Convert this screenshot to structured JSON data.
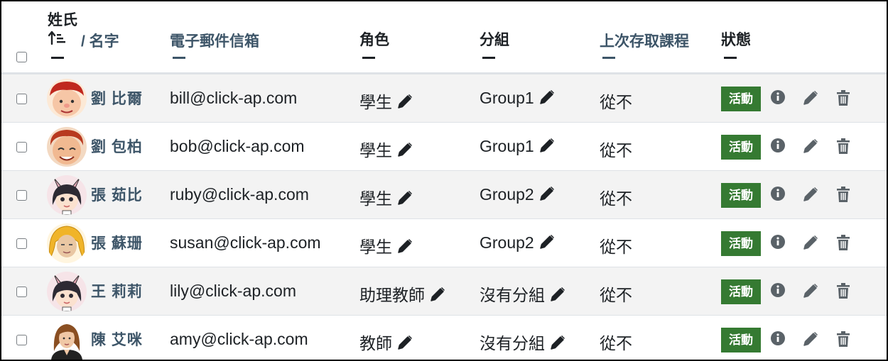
{
  "header": {
    "name_first": "姓氏",
    "name_last": "/ 名字",
    "email": "電子郵件信箱",
    "role": "角色",
    "group": "分組",
    "last_access": "上次存取課程",
    "status": "狀態"
  },
  "colors": {
    "link": "#3d5568",
    "badge_bg": "#357a32",
    "row_alt": "#f3f3f3",
    "icon": "#5a6268"
  },
  "rows": [
    {
      "name": "劉 比爾",
      "email": "bill@click-ap.com",
      "role": "學生",
      "group": "Group1",
      "last_access": "從不",
      "status": "活動",
      "avatar": "red-hair-boy-avatar"
    },
    {
      "name": "劉 包柏",
      "email": "bob@click-ap.com",
      "role": "學生",
      "group": "Group1",
      "last_access": "從不",
      "status": "活動",
      "avatar": "red-curly-boy-avatar"
    },
    {
      "name": "張 茹比",
      "email": "ruby@click-ap.com",
      "role": "學生",
      "group": "Group2",
      "last_access": "從不",
      "status": "活動",
      "avatar": "girl-bunny-ears-avatar"
    },
    {
      "name": "張 蘇珊",
      "email": "susan@click-ap.com",
      "role": "學生",
      "group": "Group2",
      "last_access": "從不",
      "status": "活動",
      "avatar": "blonde-woman-avatar"
    },
    {
      "name": "王 莉莉",
      "email": "lily@click-ap.com",
      "role": "助理教師",
      "group": "沒有分組",
      "last_access": "從不",
      "status": "活動",
      "avatar": "girl-bunny-ears-avatar"
    },
    {
      "name": "陳 艾咪",
      "email": "amy@click-ap.com",
      "role": "教師",
      "group": "沒有分組",
      "last_access": "從不",
      "status": "活動",
      "avatar": "brown-hair-woman-avatar"
    }
  ]
}
